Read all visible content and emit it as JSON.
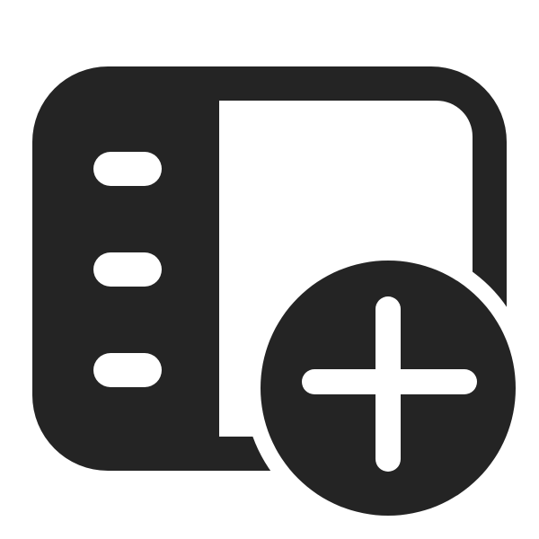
{
  "icon": {
    "name": "sidebar-add-icon",
    "components": [
      "window-frame",
      "sidebar-panel",
      "sidebar-item-1",
      "sidebar-item-2",
      "sidebar-item-3",
      "add-badge",
      "plus-sign"
    ]
  },
  "colors": {
    "background": "#ffffff",
    "foreground": "#242424",
    "accent_inner": "#ffffff"
  }
}
